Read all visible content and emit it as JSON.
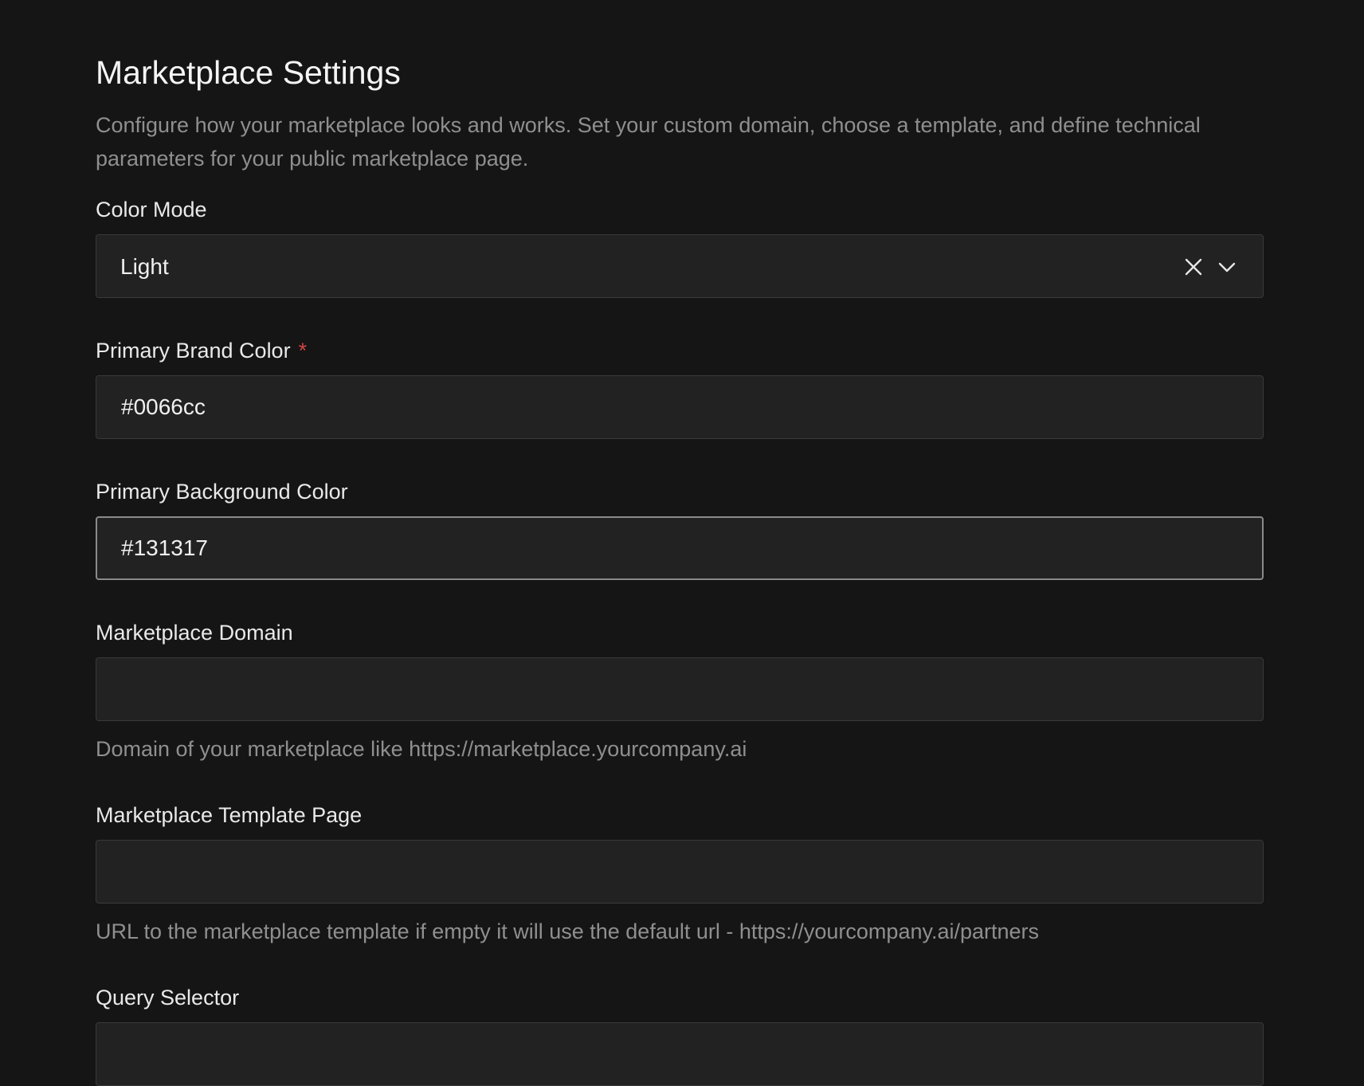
{
  "page": {
    "title": "Marketplace Settings",
    "description": "Configure how your marketplace looks and works. Set your custom domain, choose a template, and define technical parameters for your public marketplace page."
  },
  "fields": {
    "color_mode": {
      "label": "Color Mode",
      "value": "Light"
    },
    "primary_brand_color": {
      "label": "Primary Brand Color",
      "required_marker": "*",
      "value": "#0066cc"
    },
    "primary_background_color": {
      "label": "Primary Background Color",
      "value": "#131317"
    },
    "marketplace_domain": {
      "label": "Marketplace Domain",
      "value": "",
      "helper": "Domain of your marketplace like https://marketplace.yourcompany.ai"
    },
    "marketplace_template_page": {
      "label": "Marketplace Template Page",
      "value": "",
      "helper": "URL to the marketplace template if empty it will use the default url - https://yourcompany.ai/partners"
    },
    "query_selector": {
      "label": "Query Selector",
      "value": ""
    }
  },
  "icons": {
    "clear": "close-icon",
    "dropdown": "chevron-down-icon"
  },
  "colors": {
    "background": "#151515",
    "field_background": "#222222",
    "required": "#d14343",
    "muted_text": "#8f8f8f"
  }
}
